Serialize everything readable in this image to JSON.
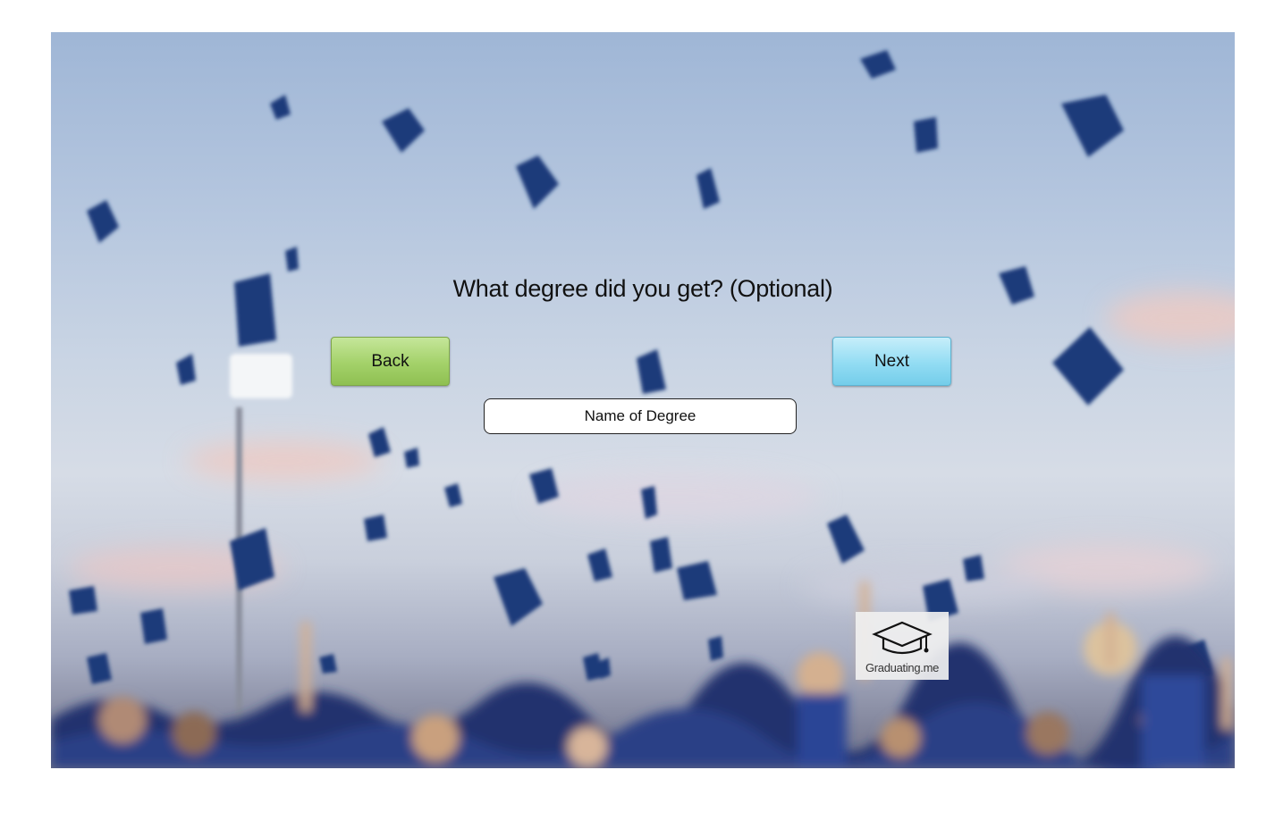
{
  "question": "What degree did you get? (Optional)",
  "buttons": {
    "back_label": "Back",
    "next_label": "Next"
  },
  "degree_field": {
    "placeholder": "Name of Degree",
    "value": ""
  },
  "logo": {
    "text": "Graduating.me",
    "icon": "graduation-cap-icon"
  },
  "colors": {
    "back_button": "#a3d169",
    "next_button": "#92dcf3",
    "sky": "#b6c7df",
    "caps": "#1d3a7a"
  }
}
